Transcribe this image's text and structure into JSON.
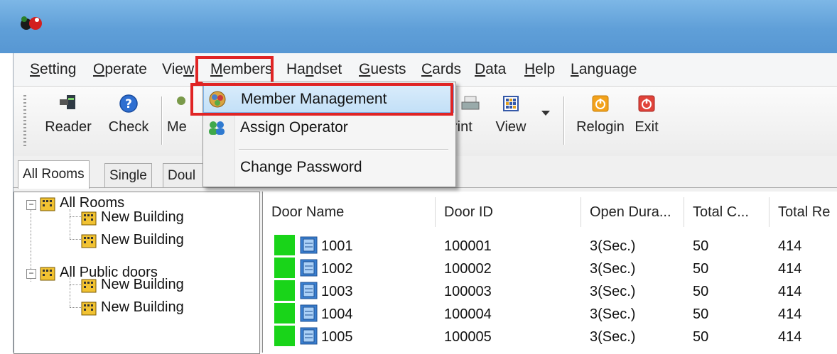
{
  "menubar": {
    "items": [
      {
        "pre": "",
        "mn": "S",
        "post": "etting"
      },
      {
        "pre": "",
        "mn": "O",
        "post": "perate"
      },
      {
        "pre": "Vie",
        "mn": "w",
        "post": ""
      },
      {
        "pre": "",
        "mn": "M",
        "post": "embers"
      },
      {
        "pre": "Ha",
        "mn": "n",
        "post": "dset"
      },
      {
        "pre": "",
        "mn": "G",
        "post": "uests"
      },
      {
        "pre": "",
        "mn": "C",
        "post": "ards"
      },
      {
        "pre": "",
        "mn": "D",
        "post": "ata"
      },
      {
        "pre": "",
        "mn": "H",
        "post": "elp"
      },
      {
        "pre": "",
        "mn": "L",
        "post": "anguage"
      }
    ]
  },
  "toolbar": {
    "reader": "Reader",
    "check": "Check",
    "members_partial": "Me",
    "print_partial": "rint",
    "view": "View",
    "relogin": "Relogin",
    "exit": "Exit"
  },
  "tabs": [
    "All Rooms",
    "Single",
    "Doul"
  ],
  "tree": {
    "all_rooms": "All Rooms",
    "building_1": "New Building",
    "building_2": "New Building",
    "public_doors": "All Public doors",
    "building_3": "New Building",
    "building_4": "New Building"
  },
  "list": {
    "headers": [
      "Door Name",
      "Door ID",
      "Open Dura...",
      "Total C...",
      "Total Re"
    ],
    "rows": [
      {
        "name": "1001",
        "id": "100001",
        "open": "3(Sec.)",
        "total_c": "50",
        "total_re": "414"
      },
      {
        "name": "1002",
        "id": "100002",
        "open": "3(Sec.)",
        "total_c": "50",
        "total_re": "414"
      },
      {
        "name": "1003",
        "id": "100003",
        "open": "3(Sec.)",
        "total_c": "50",
        "total_re": "414"
      },
      {
        "name": "1004",
        "id": "100004",
        "open": "3(Sec.)",
        "total_c": "50",
        "total_re": "414"
      },
      {
        "name": "1005",
        "id": "100005",
        "open": "3(Sec.)",
        "total_c": "50",
        "total_re": "414"
      }
    ]
  },
  "members_menu": {
    "member_management": "Member Management",
    "assign_operator": "Assign Operator",
    "change_password": "Change Password"
  },
  "colors": {
    "highlight_red": "#e02424",
    "status_green": "#19d419",
    "titlebar_blue": "#5f9fd8"
  }
}
